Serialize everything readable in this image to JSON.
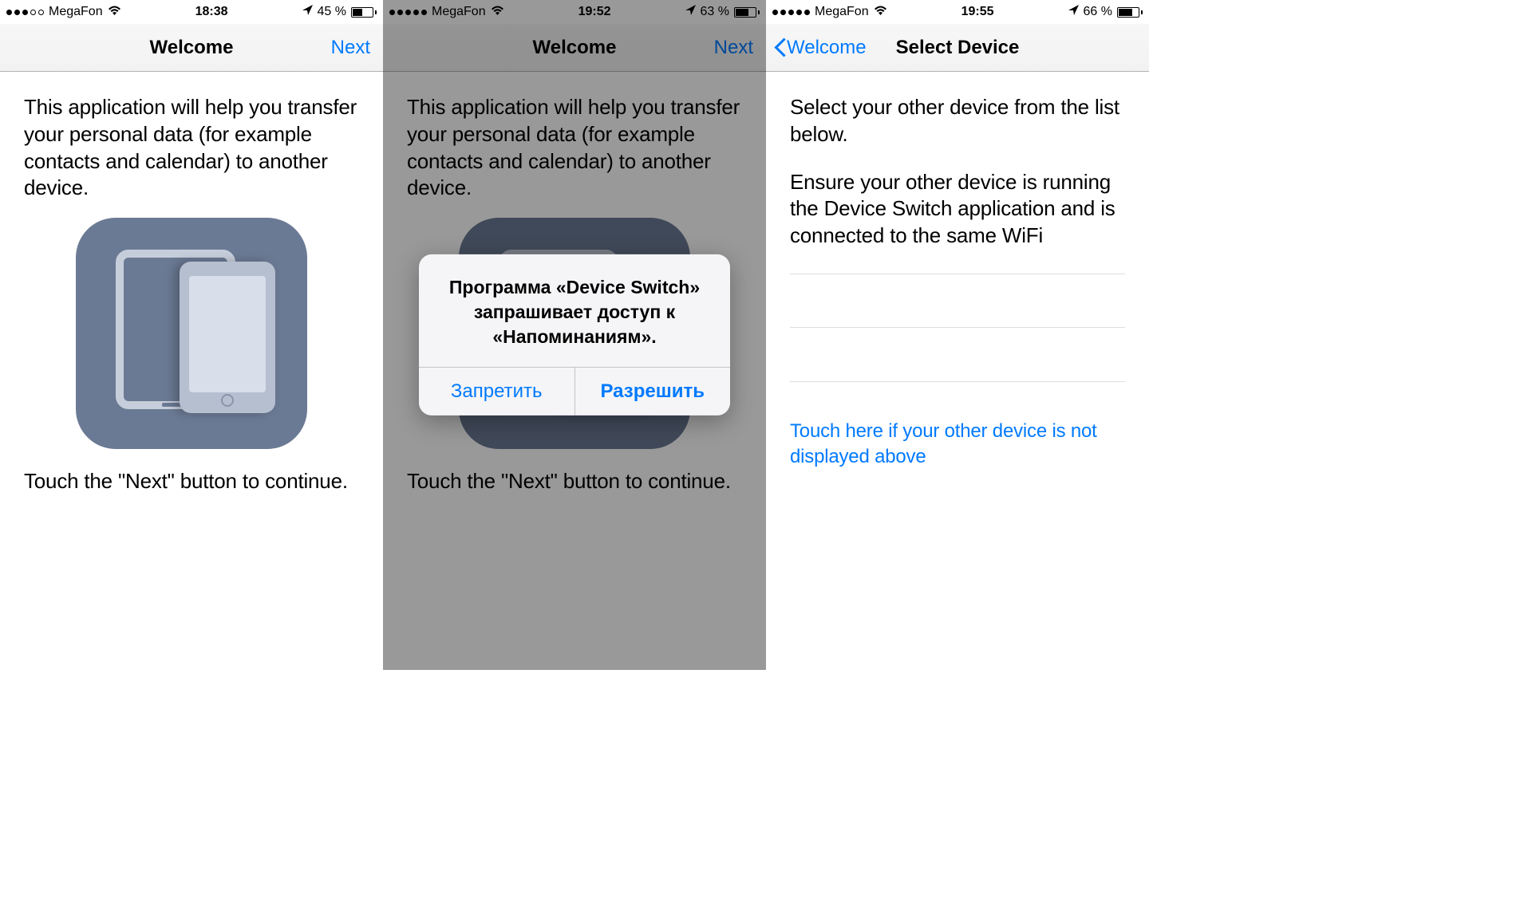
{
  "screen1": {
    "status": {
      "carrier": "MegaFon",
      "time": "18:38",
      "battery_pct": "45 %",
      "signal_filled": 3
    },
    "nav": {
      "title": "Welcome",
      "next": "Next"
    },
    "intro": "This application will help you transfer your personal data (for example contacts and calendar) to another device.",
    "hint": "Touch the \"Next\" button to continue."
  },
  "screen2": {
    "status": {
      "carrier": "MegaFon",
      "time": "19:52",
      "battery_pct": "63 %",
      "signal_filled": 5
    },
    "nav": {
      "title": "Welcome",
      "next": "Next"
    },
    "intro": "This application will help you transfer your personal data (for example contacts and calendar) to another device.",
    "hint": "Touch the \"Next\" button to continue.",
    "alert": {
      "message": "Программа «Device Switch» запрашивает доступ к «Напоминаниям».",
      "deny": "Запретить",
      "allow": "Разрешить"
    }
  },
  "screen3": {
    "status": {
      "carrier": "MegaFon",
      "time": "19:55",
      "battery_pct": "66 %",
      "signal_filled": 5
    },
    "nav": {
      "back": "Welcome",
      "title": "Select Device"
    },
    "para1": "Select your other device from the list below.",
    "para2": "Ensure your other device is running the Device Switch application and is connected to the same WiFi",
    "help": "Touch here if your other device is not displayed above"
  }
}
